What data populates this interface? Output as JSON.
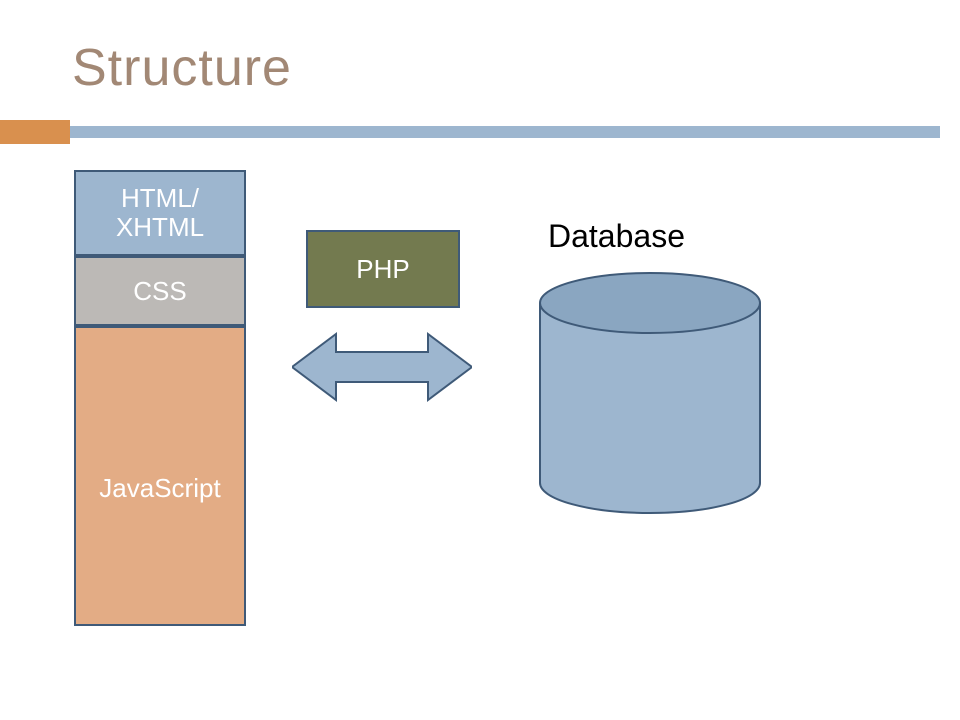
{
  "title": "Structure",
  "stack": {
    "html": "HTML/\nXHTML",
    "css": "CSS",
    "js": "JavaScript"
  },
  "php": {
    "label": "PHP"
  },
  "database": {
    "label": "Database"
  },
  "colors": {
    "accent": "#d9904e",
    "rule": "#9db6cf",
    "title": "#a28875",
    "stack_html": "#9db6cf",
    "stack_css": "#bcb9b6",
    "stack_js": "#e3ac85",
    "php": "#737a4f",
    "cylinder_fill": "#9db6cf",
    "cylinder_stroke": "#3f5a78",
    "arrow_fill": "#9db6cf",
    "arrow_stroke": "#3f5a78"
  }
}
